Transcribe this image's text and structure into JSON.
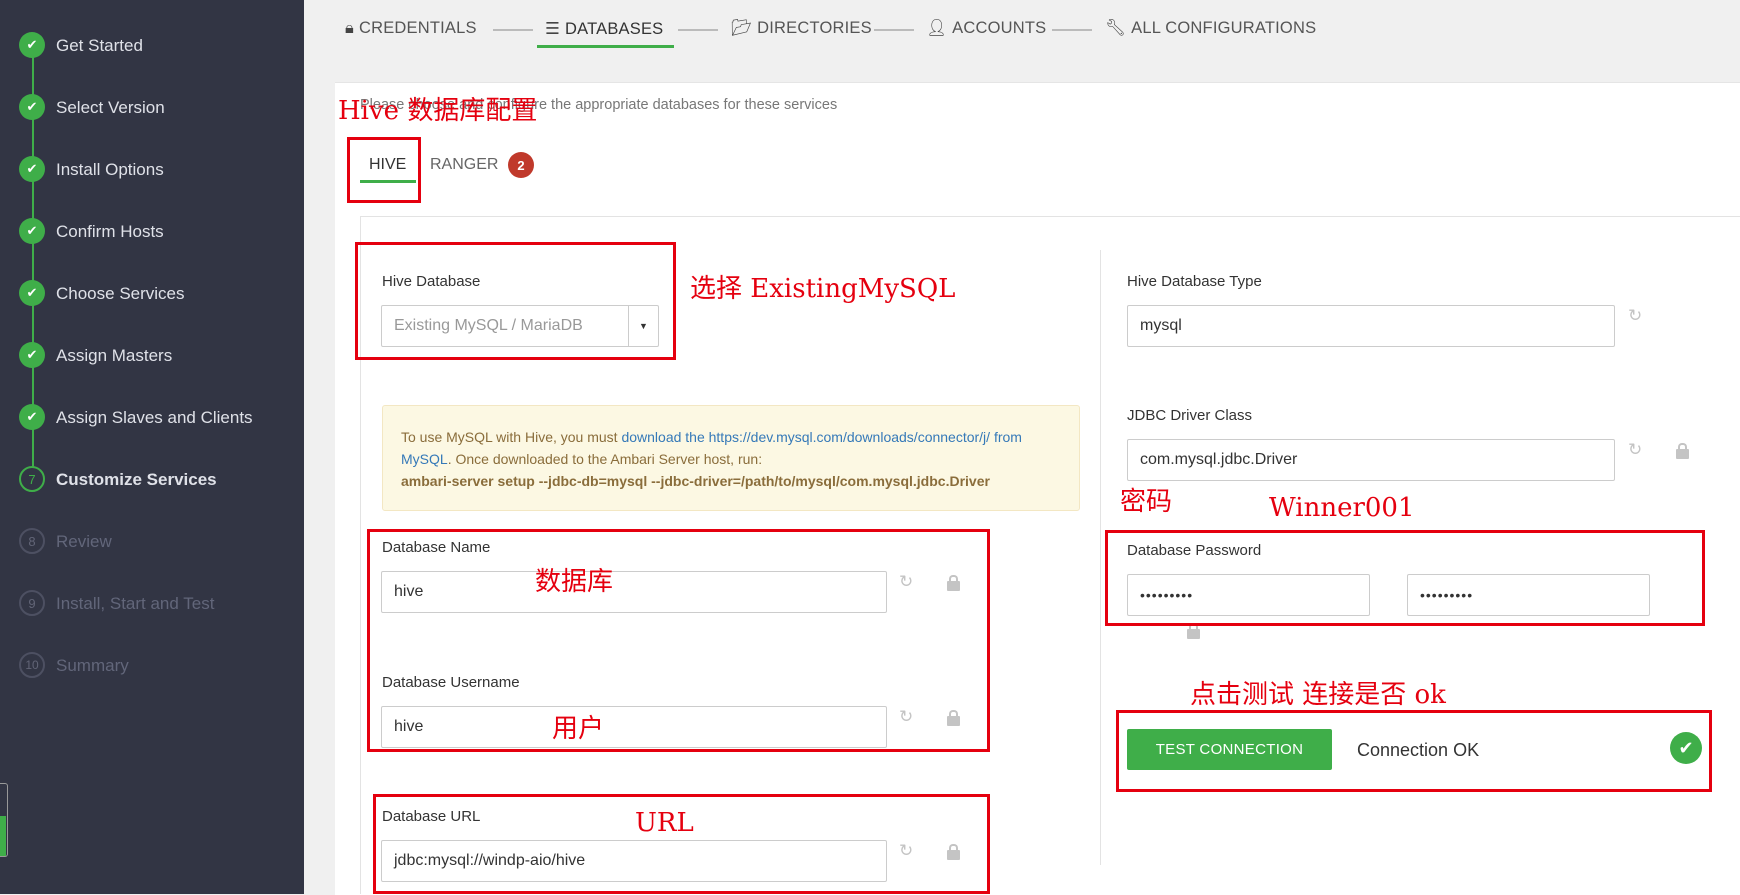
{
  "sidebar": {
    "steps": [
      {
        "num": "1",
        "label": "Get Started",
        "state": "done"
      },
      {
        "num": "2",
        "label": "Select Version",
        "state": "done"
      },
      {
        "num": "3",
        "label": "Install Options",
        "state": "done"
      },
      {
        "num": "4",
        "label": "Confirm Hosts",
        "state": "done"
      },
      {
        "num": "5",
        "label": "Choose Services",
        "state": "done"
      },
      {
        "num": "6",
        "label": "Assign Masters",
        "state": "done"
      },
      {
        "num": "7",
        "label": "Assign Slaves and Clients",
        "state": "done"
      },
      {
        "num": "7",
        "label": "Customize Services",
        "state": "current"
      },
      {
        "num": "8",
        "label": "Review",
        "state": "future"
      },
      {
        "num": "9",
        "label": "Install, Start and Test",
        "state": "future"
      },
      {
        "num": "10",
        "label": "Summary",
        "state": "future"
      }
    ]
  },
  "top_tabs": [
    {
      "label": "CREDENTIALS",
      "icon": "lock-icon"
    },
    {
      "label": "DATABASES",
      "icon": "database-icon",
      "active": true
    },
    {
      "label": "DIRECTORIES",
      "icon": "folder-icon"
    },
    {
      "label": "ACCOUNTS",
      "icon": "user-icon"
    },
    {
      "label": "ALL CONFIGURATIONS",
      "icon": "wrench-icon"
    }
  ],
  "intro": "Please choose and configure the appropriate databases for these services",
  "service_tabs": {
    "hive": "HIVE",
    "ranger": "RANGER",
    "ranger_badge": "2"
  },
  "hive_database": {
    "label": "Hive Database",
    "placeholder": "Existing MySQL / MariaDB"
  },
  "alert": {
    "text1": "To use MySQL with Hive, you must ",
    "link": "download the https://dev.mysql.com/downloads/connector/j/ from MySQL",
    "text2": ". Once downloaded to the Ambari Server host, run:",
    "command": "ambari-server setup --jdbc-db=mysql --jdbc-driver=/path/to/mysql/com.mysql.jdbc.Driver"
  },
  "database_name": {
    "label": "Database Name",
    "value": "hive"
  },
  "database_username": {
    "label": "Database Username",
    "value": "hive"
  },
  "database_url": {
    "label": "Database URL",
    "value": "jdbc:mysql://windp-aio/hive"
  },
  "hive_database_type": {
    "label": "Hive Database Type",
    "value": "mysql"
  },
  "jdbc_driver_class": {
    "label": "JDBC Driver Class",
    "value": "com.mysql.jdbc.Driver"
  },
  "database_password": {
    "label": "Database Password",
    "value": "•••••••••",
    "confirm": "•••••••••"
  },
  "test": {
    "button": "TEST CONNECTION",
    "status": "Connection OK"
  },
  "annotations": {
    "hive_db_config": "Hive 数据库配置",
    "select_existing": "选择 ExistingMySQL",
    "database": "数据库",
    "user": "用户",
    "url": "URL",
    "password": "密码",
    "password_value": "Winner001",
    "test_hint": "点击测试 连接是否 ok"
  },
  "colors": {
    "accent": "#3fae49",
    "sidebar": "#323544",
    "annotation": "#e5000f",
    "badge": "#c0392b"
  }
}
